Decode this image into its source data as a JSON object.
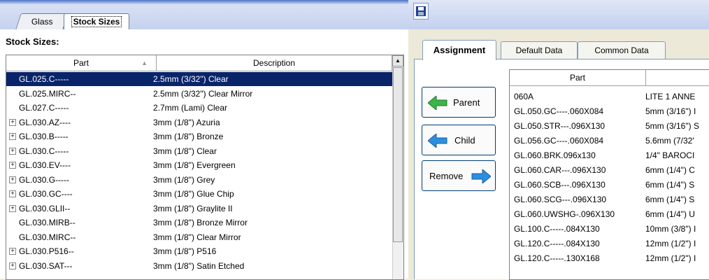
{
  "left_tabs": [
    {
      "label": "Glass"
    },
    {
      "label": "Stock Sizes"
    }
  ],
  "stock_sizes_label": "Stock Sizes:",
  "left_grid": {
    "headers": {
      "part": "Part",
      "description": "Description",
      "sort_glyph": "▲"
    },
    "rows": [
      {
        "expand": false,
        "part": "GL.025.C-----",
        "description": "2.5mm (3/32\") Clear",
        "selected": true
      },
      {
        "expand": false,
        "part": "GL.025.MIRC--",
        "description": "2.5mm (3/32\") Clear Mirror"
      },
      {
        "expand": false,
        "part": "GL.027.C-----",
        "description": "2.7mm (Lami) Clear"
      },
      {
        "expand": true,
        "part": "GL.030.AZ----",
        "description": "3mm (1/8\") Azuria"
      },
      {
        "expand": true,
        "part": "GL.030.B-----",
        "description": "3mm (1/8\") Bronze"
      },
      {
        "expand": true,
        "part": "GL.030.C-----",
        "description": "3mm (1/8\") Clear"
      },
      {
        "expand": true,
        "part": "GL.030.EV----",
        "description": "3mm (1/8\") Evergreen"
      },
      {
        "expand": true,
        "part": "GL.030.G-----",
        "description": "3mm (1/8\") Grey"
      },
      {
        "expand": true,
        "part": "GL.030.GC----",
        "description": "3mm (1/8\") Glue Chip"
      },
      {
        "expand": true,
        "part": "GL.030.GLII--",
        "description": "3mm (1/8\") Graylite II"
      },
      {
        "expand": false,
        "part": "GL.030.MIRB--",
        "description": "3mm (1/8\") Bronze Mirror"
      },
      {
        "expand": false,
        "part": "GL.030.MIRC--",
        "description": "3mm (1/8\") Clear Mirror"
      },
      {
        "expand": true,
        "part": "GL.030.P516--",
        "description": "3mm (1/8\") P516"
      },
      {
        "expand": true,
        "part": "GL.030.SAT---",
        "description": "3mm (1/8\") Satin Etched"
      }
    ]
  },
  "right_tabs": [
    {
      "label": "Assignment"
    },
    {
      "label": "Default Data"
    },
    {
      "label": "Common Data"
    }
  ],
  "buttons": {
    "parent": "Parent",
    "child": "Child",
    "remove": "Remove"
  },
  "right_grid": {
    "headers": {
      "part": "Part"
    },
    "rows": [
      {
        "part": "060A",
        "description": "LITE 1 ANNE"
      },
      {
        "part": "GL.050.GC----.060X084",
        "description": "5mm (3/16\") I"
      },
      {
        "part": "GL.050.STR---.096X130",
        "description": "5mm (3/16\") S"
      },
      {
        "part": "GL.056.GC----.060X084",
        "description": "5.6mm (7/32'"
      },
      {
        "part": "GL.060.BRK.096x130",
        "description": "1/4\" BAROCI"
      },
      {
        "part": "GL.060.CAR---.096X130",
        "description": "6mm (1/4\") C"
      },
      {
        "part": "GL.060.SCB---.096X130",
        "description": "6mm (1/4\") S"
      },
      {
        "part": "GL.060.SCG---.096X130",
        "description": "6mm (1/4\") S"
      },
      {
        "part": "GL.060.UWSHG-.096X130",
        "description": "6mm (1/4\") U"
      },
      {
        "part": "GL.100.C-----.084X130",
        "description": "10mm (3/8\") I"
      },
      {
        "part": "GL.120.C-----.084X130",
        "description": "12mm (1/2\") I"
      },
      {
        "part": "GL.120.C-----.130X168",
        "description": "12mm (1/2\") I"
      }
    ]
  },
  "colors": {
    "selection": "#0a246a",
    "arrow_green": "#3cb44a",
    "arrow_blue": "#2b8fe0"
  }
}
